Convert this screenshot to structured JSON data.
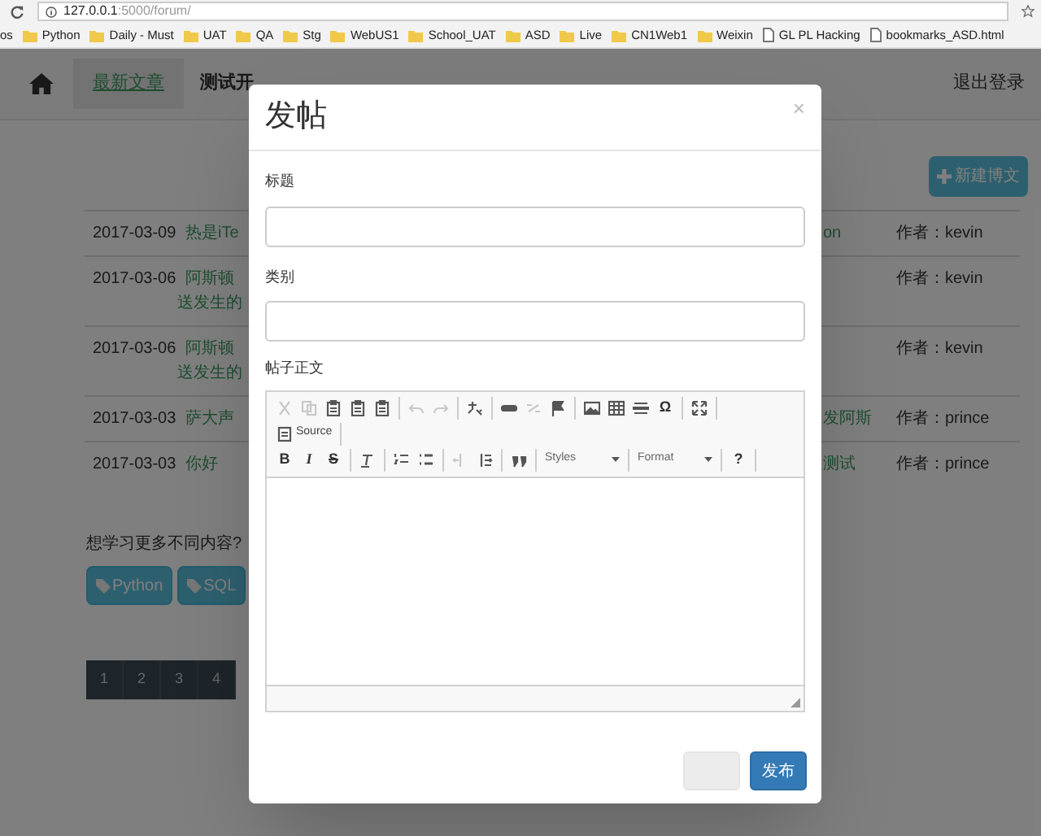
{
  "browser": {
    "host": "127.0.0.1",
    "path": ":5000/forum/",
    "bookmarks": [
      {
        "label": "os",
        "kind": "text"
      },
      {
        "label": "Python",
        "kind": "folder"
      },
      {
        "label": "Daily - Must",
        "kind": "folder"
      },
      {
        "label": "UAT",
        "kind": "folder"
      },
      {
        "label": "QA",
        "kind": "folder"
      },
      {
        "label": "Stg",
        "kind": "folder"
      },
      {
        "label": "WebUS1",
        "kind": "folder"
      },
      {
        "label": "School_UAT",
        "kind": "folder"
      },
      {
        "label": "ASD",
        "kind": "folder"
      },
      {
        "label": "Live",
        "kind": "folder"
      },
      {
        "label": "CN1Web1",
        "kind": "folder"
      },
      {
        "label": "Weixin",
        "kind": "folder"
      },
      {
        "label": "GL PL Hacking",
        "kind": "page"
      },
      {
        "label": "bookmarks_ASD.html",
        "kind": "page"
      }
    ]
  },
  "nav": {
    "tabs": [
      {
        "label": "最新文章",
        "selected": true
      },
      {
        "label": "测试开",
        "selected": false
      }
    ],
    "logout": "退出登录"
  },
  "new_post_button": "新建博文",
  "posts": [
    {
      "date": "2017-03-09",
      "title": [
        "热是iTe"
      ],
      "column_3": "on",
      "author": "作者：kevin"
    },
    {
      "date": "2017-03-06",
      "title": [
        "阿斯顿",
        "送发生的"
      ],
      "author": "作者：kevin"
    },
    {
      "date": "2017-03-06",
      "title": [
        "阿斯顿",
        "送发生的"
      ],
      "author": "作者：kevin"
    },
    {
      "date": "2017-03-03",
      "title": [
        "萨大声"
      ],
      "column_3": "发阿斯",
      "author": "作者：prince"
    },
    {
      "date": "2017-03-03",
      "title": [
        "你好"
      ],
      "column_3": "测试",
      "author": "作者：prince"
    }
  ],
  "more_prompt": "想学习更多不同内容?",
  "tags": [
    "Python",
    "SQL"
  ],
  "pages": [
    "1",
    "2",
    "3",
    "4"
  ],
  "dialog": {
    "title": "发帖",
    "close": "×",
    "fields": [
      {
        "label": "标题"
      },
      {
        "label": "类别"
      }
    ],
    "body_label": "帖子正文",
    "toolbar": [
      [
        [
          {
            "kind": "cut",
            "disabled": true
          },
          {
            "kind": "copy",
            "disabled": true
          },
          {
            "kind": "paste",
            "disabled": false
          },
          {
            "kind": "paste",
            "disabled": false
          },
          {
            "kind": "paste",
            "disabled": false
          }
        ],
        [
          {
            "kind": "undo",
            "disabled": true
          },
          {
            "kind": "redo",
            "disabled": true
          }
        ],
        [
          {
            "kind": "spell",
            "disabled": false
          }
        ],
        [
          {
            "kind": "link",
            "disabled": false
          },
          {
            "kind": "unlink",
            "disabled": true
          },
          {
            "kind": "flag",
            "disabled": false
          }
        ],
        [
          {
            "kind": "image",
            "disabled": false
          },
          {
            "kind": "table",
            "disabled": false
          },
          {
            "kind": "rule",
            "disabled": false
          },
          {
            "kind": "glyph",
            "label": "Ω",
            "disabled": false
          }
        ],
        [
          {
            "kind": "maximize",
            "disabled": false
          }
        ]
      ],
      [
        [
          {
            "kind": "source",
            "label": "Source",
            "disabled": false
          }
        ]
      ],
      [
        [
          {
            "kind": "bold",
            "label": "B",
            "disabled": false
          },
          {
            "kind": "italic",
            "label": "I",
            "disabled": false
          },
          {
            "kind": "strike",
            "label": "S",
            "disabled": false
          }
        ],
        [
          {
            "kind": "clear",
            "disabled": false
          }
        ],
        [
          {
            "kind": "numbered",
            "disabled": false
          },
          {
            "kind": "bulleted",
            "disabled": false
          }
        ],
        [
          {
            "kind": "outdent",
            "disabled": true
          },
          {
            "kind": "indent",
            "disabled": false
          }
        ],
        [
          {
            "kind": "quote",
            "disabled": false
          }
        ],
        [
          {
            "kind": "combo",
            "label": "Styles",
            "disabled": false
          }
        ],
        [
          {
            "kind": "combo",
            "label": "Format",
            "disabled": false
          }
        ],
        [
          {
            "kind": "glyph",
            "label": "?",
            "disabled": false
          }
        ]
      ]
    ],
    "buttons": [
      {
        "kind": "secondary",
        "disabled": true
      },
      {
        "kind": "primary",
        "label": "发布",
        "disabled": false
      }
    ]
  }
}
